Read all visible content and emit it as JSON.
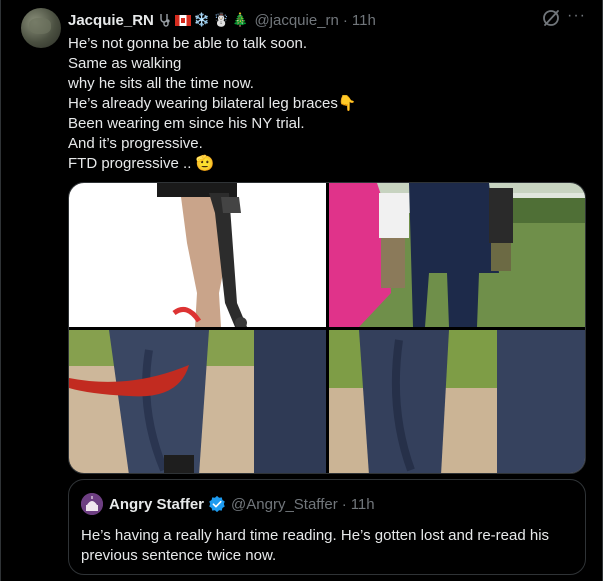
{
  "tweet": {
    "name": "Jacquie_RN",
    "handle": "@jacquie_rn",
    "time": "11h",
    "separator": "·",
    "more": "···",
    "lines": [
      "He’s not gonna be able to talk soon.",
      "Same as walking",
      "why he sits all the time now.",
      "He’s already wearing bilateral leg braces👇",
      "Been wearing em since his NY trial.",
      "And it’s progressive.",
      "FTD progressive .. 🫡"
    ],
    "name_emojis": [
      "stethoscope",
      "canadian-flag",
      "❄️",
      "☃️",
      "🎄"
    ]
  },
  "quote": {
    "name": "Angry Staffer",
    "handle": "@Angry_Staffer",
    "separator": "·",
    "time": "11h",
    "text": "He’s having a really hard time reading. He’s gotten lost and re-read his previous sentence twice now."
  },
  "colors": {
    "background": "#000000",
    "text": "#e7e9ea",
    "muted": "#71767b",
    "border": "#2f3336",
    "verified": "#1d9bf0"
  }
}
